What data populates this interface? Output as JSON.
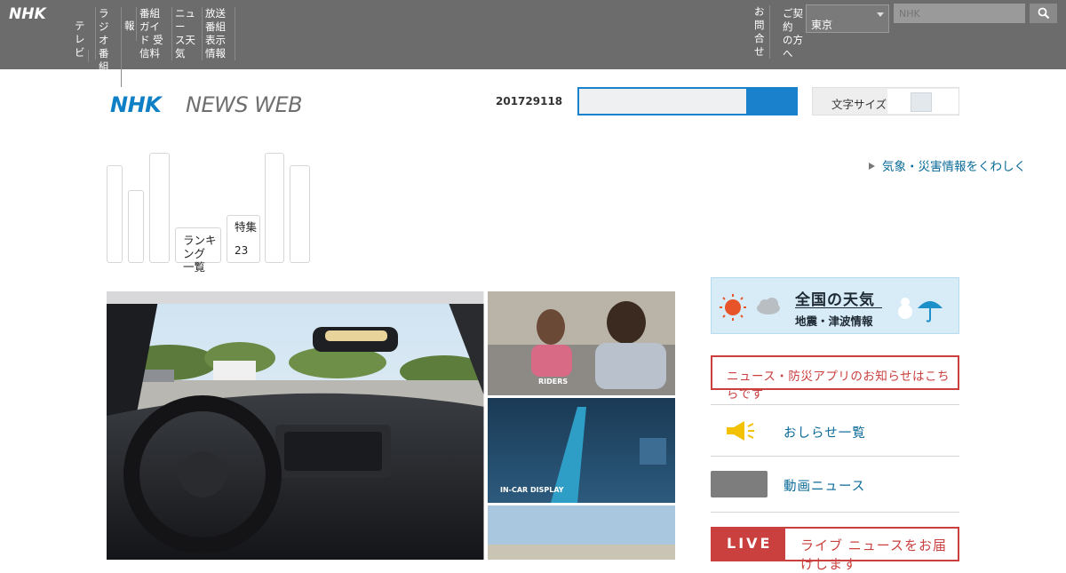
{
  "global_bar": {
    "logo": "NHK",
    "links": [
      {
        "label": "テレ ビ"
      },
      {
        "label": "ラジオ 番組表"
      },
      {
        "label": "報"
      },
      {
        "label": "番組ガイド 受信料"
      },
      {
        "label": "ニュー ス天気"
      },
      {
        "label": "放送 番組表示 情報"
      }
    ],
    "right_links": [
      {
        "label": "お問 合せ"
      },
      {
        "label": "ご契約 の方へ"
      }
    ],
    "select_value": "東京",
    "search_placeholder": "NHK"
  },
  "header": {
    "logo_nhk": "NHK",
    "logo_newsweb": "NEWS WEB",
    "date": "201729118",
    "search_placeholder": "",
    "toggle_label": "文字サイズ"
  },
  "categories": [
    {
      "label": ""
    },
    {
      "label": ""
    },
    {
      "label": ""
    },
    {
      "label": "ランキング 一覧"
    },
    {
      "label": "特集",
      "count": "23"
    },
    {
      "label": ""
    },
    {
      "label": ""
    }
  ],
  "weather_link": "気象・災害情報をくわしく",
  "side": {
    "weather_title": "全国の天気",
    "weather_sub": "地震・津波情報",
    "notice": "ニュース・防災アプリのお知らせはこちらです",
    "link1": "おしらせ一覧",
    "link2": "動画ニュース",
    "live_tag": "LIVE",
    "live_text": "ライブ ニュースをお届けします"
  },
  "photo": {
    "label_riders": "RIDERS",
    "label_incar": "IN-CAR DISPLAY"
  },
  "colors": {
    "global_bar": "#6c6c6c",
    "brand_blue": "#0f7fc6",
    "search_blue": "#1a81cc",
    "alert_red": "#c9403f",
    "link_teal": "#0a6a98"
  }
}
